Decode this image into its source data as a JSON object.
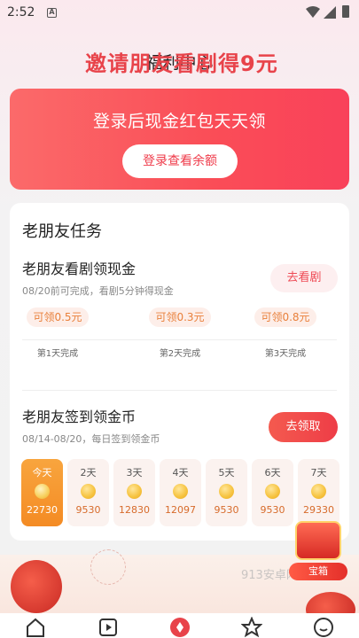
{
  "status_bar": {
    "time": "2:52",
    "notif_icon": "A"
  },
  "page": {
    "title": "福利中心"
  },
  "banner": {
    "title": "登录后现金红包天天领",
    "button": "登录查看余额"
  },
  "old_friend": {
    "section_title": "老朋友任务",
    "watch_task": {
      "title": "老朋友看剧领现金",
      "subtitle": "08/20前可完成，看剧5分钟得现金",
      "button": "去看剧",
      "rewards": [
        {
          "amount": "可领0.5元",
          "day": "第1天完成"
        },
        {
          "amount": "可领0.3元",
          "day": "第2天完成"
        },
        {
          "amount": "可领0.8元",
          "day": "第3天完成"
        }
      ]
    },
    "signin_task": {
      "title": "老朋友签到领金币",
      "subtitle": "08/14-08/20，每日签到领金币",
      "button": "去领取",
      "days": [
        {
          "label": "今天",
          "amount": "22730"
        },
        {
          "label": "2天",
          "amount": "9530"
        },
        {
          "label": "3天",
          "amount": "12830"
        },
        {
          "label": "4天",
          "amount": "12097"
        },
        {
          "label": "5天",
          "amount": "9530"
        },
        {
          "label": "6天",
          "amount": "9530"
        },
        {
          "label": "7天",
          "amount": "29330"
        }
      ]
    }
  },
  "promo": {
    "text": "邀请朋友看剧得9元"
  },
  "treasure": {
    "label": "宝箱"
  },
  "watermark": "913安卓网",
  "colors": {
    "accent_red": "#fa4d57",
    "accent_orange": "#f48b24"
  },
  "nav": [
    "home-icon",
    "play-icon",
    "welfare-icon",
    "star-icon",
    "profile-icon"
  ]
}
